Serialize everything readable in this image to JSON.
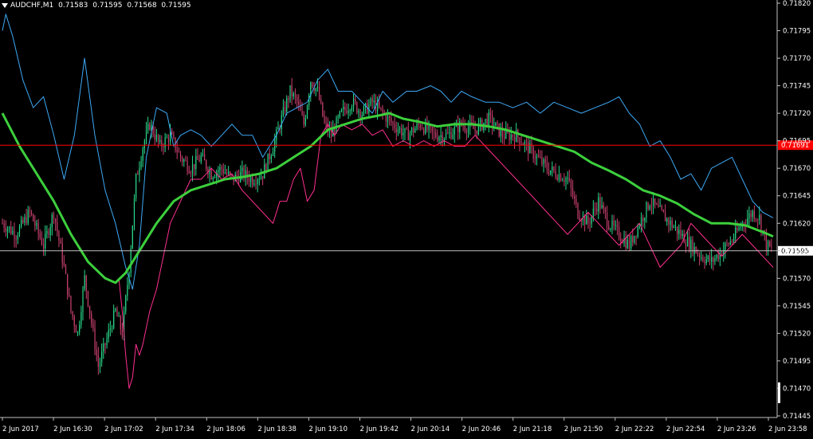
{
  "header": {
    "symbol": "AUDCHF,M1",
    "open": "0.71583",
    "high": "0.71595",
    "low": "0.71568",
    "close": "0.71595"
  },
  "colors": {
    "background": "#000000",
    "grid_axis": "#c0c0c0",
    "bull_candle": "#29d98a",
    "bear_candle": "#c8406e",
    "up_line": "#3da9f5",
    "down_line": "#ff2f8f",
    "ma_line": "#3ccf3c",
    "red_level": "#ff0000",
    "white_level": "#c0c0c0"
  },
  "chart_data": {
    "type": "line",
    "title": "AUDCHF,M1",
    "ylim": [
      0.71445,
      0.7182
    ],
    "y_ticks": [
      "0.71820",
      "0.71795",
      "0.71770",
      "0.71745",
      "0.71720",
      "0.71695",
      "0.71670",
      "0.71645",
      "0.71620",
      "0.71595",
      "0.71570",
      "0.71545",
      "0.71520",
      "0.71495",
      "0.71470",
      "0.71445"
    ],
    "x_ticks": [
      "2 Jun 2017",
      "2 Jun 16:30",
      "2 Jun 17:02",
      "2 Jun 17:34",
      "2 Jun 18:06",
      "2 Jun 18:38",
      "2 Jun 19:10",
      "2 Jun 19:42",
      "2 Jun 20:14",
      "2 Jun 20:46",
      "2 Jun 21:18",
      "2 Jun 21:50",
      "2 Jun 22:22",
      "2 Jun 22:54",
      "2 Jun 23:26",
      "2 Jun 23:58"
    ],
    "price_levels": [
      {
        "value": 0.71691,
        "label": "0.71691",
        "color": "#ff0000"
      },
      {
        "value": 0.71595,
        "label": "0.71595",
        "color": "#c0c0c0"
      }
    ],
    "series": [
      {
        "role": "upper-envelope",
        "color": "#3da9f5",
        "points": [
          [
            0,
            0.71795
          ],
          [
            2,
            0.7181
          ],
          [
            6,
            0.7179
          ],
          [
            12,
            0.7175
          ],
          [
            18,
            0.71725
          ],
          [
            24,
            0.71735
          ],
          [
            30,
            0.717
          ],
          [
            36,
            0.7166
          ],
          [
            42,
            0.717
          ],
          [
            48,
            0.7177
          ],
          [
            54,
            0.717
          ],
          [
            60,
            0.7165
          ],
          [
            66,
            0.7162
          ],
          [
            72,
            0.7158
          ],
          [
            76,
            0.7156
          ],
          [
            80,
            0.716
          ],
          [
            84,
            0.7168
          ],
          [
            90,
            0.71725
          ],
          [
            96,
            0.7172
          ],
          [
            100,
            0.7169
          ],
          [
            104,
            0.717
          ],
          [
            110,
            0.71705
          ],
          [
            116,
            0.717
          ],
          [
            122,
            0.7169
          ],
          [
            128,
            0.717
          ],
          [
            134,
            0.7171
          ],
          [
            140,
            0.717
          ],
          [
            146,
            0.717
          ],
          [
            152,
            0.7168
          ],
          [
            160,
            0.717
          ],
          [
            166,
            0.7172
          ],
          [
            172,
            0.71725
          ],
          [
            178,
            0.7173
          ],
          [
            184,
            0.7175
          ],
          [
            190,
            0.7176
          ],
          [
            196,
            0.7174
          ],
          [
            204,
            0.7174
          ],
          [
            210,
            0.7173
          ],
          [
            216,
            0.7172
          ],
          [
            222,
            0.7174
          ],
          [
            228,
            0.7173
          ],
          [
            236,
            0.7174
          ],
          [
            242,
            0.7174
          ],
          [
            250,
            0.71745
          ],
          [
            256,
            0.7174
          ],
          [
            262,
            0.7173
          ],
          [
            268,
            0.7174
          ],
          [
            274,
            0.71735
          ],
          [
            282,
            0.7173
          ],
          [
            290,
            0.7173
          ],
          [
            298,
            0.71725
          ],
          [
            306,
            0.7173
          ],
          [
            314,
            0.7172
          ],
          [
            322,
            0.7173
          ],
          [
            330,
            0.71725
          ],
          [
            338,
            0.7172
          ],
          [
            346,
            0.71725
          ],
          [
            354,
            0.7173
          ],
          [
            360,
            0.71735
          ],
          [
            366,
            0.7172
          ],
          [
            372,
            0.7171
          ],
          [
            378,
            0.7169
          ],
          [
            384,
            0.71695
          ],
          [
            390,
            0.7168
          ],
          [
            396,
            0.7166
          ],
          [
            402,
            0.71665
          ],
          [
            408,
            0.7165
          ],
          [
            414,
            0.7167
          ],
          [
            420,
            0.71675
          ],
          [
            426,
            0.7168
          ],
          [
            432,
            0.7166
          ],
          [
            438,
            0.7164
          ],
          [
            444,
            0.7163
          ],
          [
            450,
            0.71625
          ]
        ]
      },
      {
        "role": "lower-envelope",
        "color": "#ff2f8f",
        "points": [
          [
            68,
            0.7157
          ],
          [
            70,
            0.7154
          ],
          [
            72,
            0.715
          ],
          [
            74,
            0.7147
          ],
          [
            76,
            0.7148
          ],
          [
            78,
            0.7151
          ],
          [
            80,
            0.715
          ],
          [
            82,
            0.7151
          ],
          [
            86,
            0.7154
          ],
          [
            90,
            0.7156
          ],
          [
            94,
            0.7159
          ],
          [
            98,
            0.7162
          ],
          [
            104,
            0.7164
          ],
          [
            110,
            0.7166
          ],
          [
            116,
            0.7166
          ],
          [
            122,
            0.7167
          ],
          [
            128,
            0.7166
          ],
          [
            134,
            0.71665
          ],
          [
            140,
            0.7165
          ],
          [
            146,
            0.7164
          ],
          [
            152,
            0.7163
          ],
          [
            158,
            0.7162
          ],
          [
            162,
            0.7164
          ],
          [
            166,
            0.7164
          ],
          [
            170,
            0.7166
          ],
          [
            174,
            0.7167
          ],
          [
            178,
            0.7164
          ],
          [
            182,
            0.7165
          ],
          [
            186,
            0.717
          ],
          [
            190,
            0.7171
          ],
          [
            194,
            0.717
          ],
          [
            198,
            0.7171
          ],
          [
            204,
            0.71705
          ],
          [
            210,
            0.7171
          ],
          [
            216,
            0.717
          ],
          [
            222,
            0.71705
          ],
          [
            228,
            0.7169
          ],
          [
            234,
            0.71695
          ],
          [
            240,
            0.7169
          ],
          [
            246,
            0.71695
          ],
          [
            252,
            0.7169
          ],
          [
            258,
            0.71695
          ],
          [
            264,
            0.7169
          ],
          [
            270,
            0.7169
          ],
          [
            276,
            0.717
          ],
          [
            282,
            0.7169
          ],
          [
            288,
            0.7168
          ],
          [
            294,
            0.7167
          ],
          [
            300,
            0.7166
          ],
          [
            306,
            0.7165
          ],
          [
            312,
            0.7164
          ],
          [
            318,
            0.7163
          ],
          [
            324,
            0.7162
          ],
          [
            330,
            0.7161
          ],
          [
            336,
            0.7162
          ],
          [
            342,
            0.7163
          ],
          [
            348,
            0.7162
          ],
          [
            354,
            0.7161
          ],
          [
            360,
            0.716
          ],
          [
            366,
            0.7161
          ],
          [
            372,
            0.7162
          ],
          [
            378,
            0.716
          ],
          [
            384,
            0.7158
          ],
          [
            390,
            0.7159
          ],
          [
            396,
            0.716
          ],
          [
            402,
            0.7162
          ],
          [
            408,
            0.7161
          ],
          [
            414,
            0.716
          ],
          [
            420,
            0.7159
          ],
          [
            426,
            0.716
          ],
          [
            432,
            0.7161
          ],
          [
            438,
            0.716
          ],
          [
            444,
            0.7159
          ],
          [
            450,
            0.7158
          ]
        ]
      },
      {
        "role": "moving-average",
        "color": "#3ccf3c",
        "points": [
          [
            0,
            0.7172
          ],
          [
            10,
            0.7169
          ],
          [
            20,
            0.71665
          ],
          [
            30,
            0.7164
          ],
          [
            40,
            0.7161
          ],
          [
            50,
            0.71585
          ],
          [
            60,
            0.7157
          ],
          [
            66,
            0.71566
          ],
          [
            72,
            0.71575
          ],
          [
            80,
            0.71595
          ],
          [
            90,
            0.7162
          ],
          [
            100,
            0.7164
          ],
          [
            110,
            0.7165
          ],
          [
            120,
            0.71655
          ],
          [
            130,
            0.7166
          ],
          [
            140,
            0.71662
          ],
          [
            150,
            0.71665
          ],
          [
            160,
            0.7167
          ],
          [
            170,
            0.7168
          ],
          [
            180,
            0.7169
          ],
          [
            190,
            0.71705
          ],
          [
            200,
            0.7171
          ],
          [
            210,
            0.71715
          ],
          [
            220,
            0.71718
          ],
          [
            226,
            0.7172
          ],
          [
            234,
            0.71715
          ],
          [
            244,
            0.71712
          ],
          [
            254,
            0.71708
          ],
          [
            264,
            0.7171
          ],
          [
            274,
            0.7171
          ],
          [
            284,
            0.71708
          ],
          [
            294,
            0.71705
          ],
          [
            304,
            0.717
          ],
          [
            314,
            0.71695
          ],
          [
            324,
            0.7169
          ],
          [
            334,
            0.71685
          ],
          [
            344,
            0.71675
          ],
          [
            354,
            0.71668
          ],
          [
            364,
            0.7166
          ],
          [
            374,
            0.7165
          ],
          [
            384,
            0.71645
          ],
          [
            394,
            0.71638
          ],
          [
            404,
            0.71628
          ],
          [
            414,
            0.7162
          ],
          [
            424,
            0.7162
          ],
          [
            434,
            0.71618
          ],
          [
            444,
            0.71612
          ],
          [
            450,
            0.71608
          ]
        ]
      }
    ],
    "candle_anchor_path": [
      [
        0,
        0.7162
      ],
      [
        8,
        0.7161
      ],
      [
        16,
        0.7163
      ],
      [
        24,
        0.716
      ],
      [
        30,
        0.7163
      ],
      [
        36,
        0.7158
      ],
      [
        40,
        0.7154
      ],
      [
        44,
        0.7152
      ],
      [
        48,
        0.7157
      ],
      [
        52,
        0.7153
      ],
      [
        56,
        0.7149
      ],
      [
        62,
        0.7152
      ],
      [
        66,
        0.7154
      ],
      [
        70,
        0.7152
      ],
      [
        74,
        0.7158
      ],
      [
        78,
        0.7166
      ],
      [
        82,
        0.7169
      ],
      [
        86,
        0.7171
      ],
      [
        92,
        0.7169
      ],
      [
        98,
        0.717
      ],
      [
        104,
        0.7168
      ],
      [
        110,
        0.7167
      ],
      [
        116,
        0.7168
      ],
      [
        122,
        0.71665
      ],
      [
        128,
        0.7167
      ],
      [
        134,
        0.7166
      ],
      [
        140,
        0.71665
      ],
      [
        146,
        0.7166
      ],
      [
        152,
        0.71665
      ],
      [
        158,
        0.7169
      ],
      [
        164,
        0.7172
      ],
      [
        168,
        0.7174
      ],
      [
        172,
        0.7173
      ],
      [
        176,
        0.7171
      ],
      [
        180,
        0.7175
      ],
      [
        184,
        0.7174
      ],
      [
        188,
        0.7171
      ],
      [
        192,
        0.717
      ],
      [
        198,
        0.7172
      ],
      [
        204,
        0.7173
      ],
      [
        210,
        0.7172
      ],
      [
        216,
        0.7173
      ],
      [
        222,
        0.7172
      ],
      [
        228,
        0.7171
      ],
      [
        236,
        0.717
      ],
      [
        244,
        0.7171
      ],
      [
        252,
        0.717
      ],
      [
        260,
        0.717
      ],
      [
        268,
        0.7171
      ],
      [
        276,
        0.71705
      ],
      [
        284,
        0.71715
      ],
      [
        292,
        0.717
      ],
      [
        300,
        0.717
      ],
      [
        306,
        0.7169
      ],
      [
        312,
        0.7168
      ],
      [
        318,
        0.7167
      ],
      [
        324,
        0.71665
      ],
      [
        330,
        0.7166
      ],
      [
        336,
        0.7163
      ],
      [
        342,
        0.7162
      ],
      [
        348,
        0.7164
      ],
      [
        354,
        0.7162
      ],
      [
        360,
        0.7161
      ],
      [
        366,
        0.716
      ],
      [
        372,
        0.7162
      ],
      [
        378,
        0.7164
      ],
      [
        384,
        0.7163
      ],
      [
        390,
        0.7162
      ],
      [
        396,
        0.7161
      ],
      [
        402,
        0.716
      ],
      [
        408,
        0.7159
      ],
      [
        414,
        0.71585
      ],
      [
        420,
        0.71595
      ],
      [
        426,
        0.71605
      ],
      [
        432,
        0.7162
      ],
      [
        438,
        0.7163
      ],
      [
        442,
        0.71625
      ],
      [
        446,
        0.716
      ],
      [
        450,
        0.71595
      ]
    ]
  }
}
